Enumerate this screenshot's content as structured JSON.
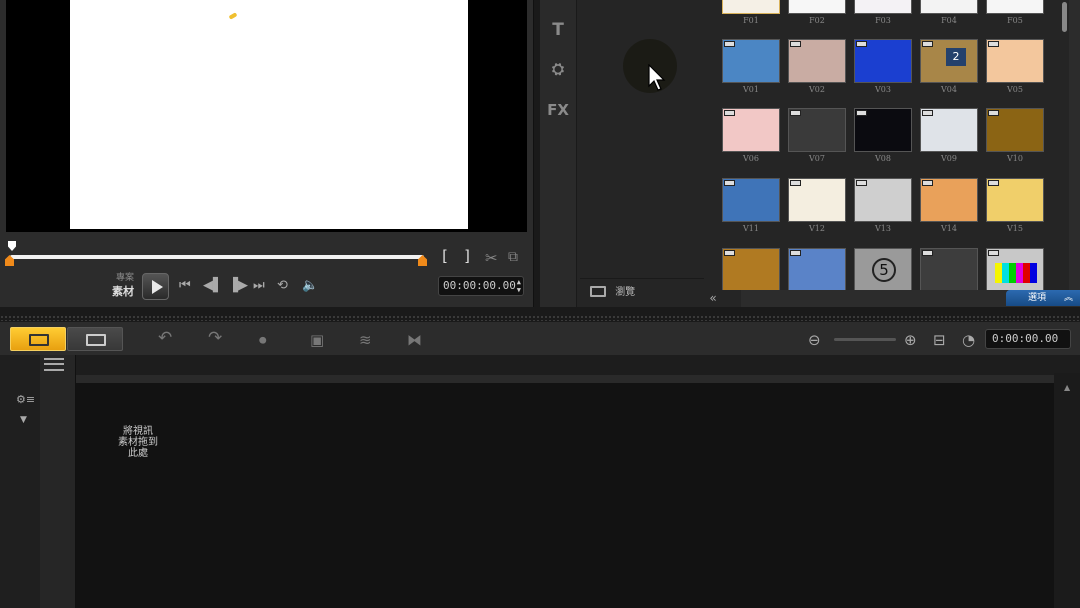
{
  "preview": {
    "mode_project": "專案",
    "mode_clip": "素材",
    "timecode": "00:00:00.00",
    "mark_in": "[",
    "mark_out": "]"
  },
  "library": {
    "side_tools": [
      "T",
      "FX"
    ],
    "browse_label": "瀏覽",
    "options_label": "選項",
    "thumbs": [
      {
        "label": "F01",
        "color": "#f5f0e6",
        "video": false
      },
      {
        "label": "F02",
        "color": "#f7f7f7",
        "video": false
      },
      {
        "label": "F03",
        "color": "#f4f2f5",
        "video": false
      },
      {
        "label": "F04",
        "color": "#f3f3f3",
        "video": false
      },
      {
        "label": "F05",
        "color": "#f6f6f6",
        "video": false
      },
      {
        "label": "V01",
        "color": "#4b86c4",
        "video": true
      },
      {
        "label": "V02",
        "color": "#c9aca3",
        "video": true
      },
      {
        "label": "V03",
        "color": "#1b3fd0",
        "video": true
      },
      {
        "label": "V04",
        "color": "#a88648",
        "video": true
      },
      {
        "label": "V05",
        "color": "#f3c79d",
        "video": true
      },
      {
        "label": "V06",
        "color": "#f2c8c6",
        "video": true
      },
      {
        "label": "V07",
        "color": "#3a3a3a",
        "video": true
      },
      {
        "label": "V08",
        "color": "#0b0b10",
        "video": true
      },
      {
        "label": "V09",
        "color": "#dfe3e8",
        "video": true
      },
      {
        "label": "V10",
        "color": "#8b6414",
        "video": true
      },
      {
        "label": "V11",
        "color": "#3f74b8",
        "video": true
      },
      {
        "label": "V12",
        "color": "#f4eee0",
        "video": true
      },
      {
        "label": "V13",
        "color": "#cfcfcf",
        "video": true
      },
      {
        "label": "V14",
        "color": "#e9a15a",
        "video": true
      },
      {
        "label": "V15",
        "color": "#f0cf6a",
        "video": true
      },
      {
        "label": "",
        "color": "#b07a22",
        "video": true
      },
      {
        "label": "",
        "color": "#5a83c8",
        "video": true
      },
      {
        "label": "",
        "color": "#9a9a9a",
        "video": false
      },
      {
        "label": "",
        "color": "#3d3d3d",
        "video": true
      },
      {
        "label": "",
        "color": "#c8c8c8",
        "video": true
      }
    ],
    "countdown_digit": "5",
    "clock_digit": "2"
  },
  "timeline": {
    "timecode": "0:00:00.00",
    "drop_hint": "將視訊\n素材拖到\n此處"
  },
  "colors": {
    "accent_gold": "#f5b72a",
    "accent_blue": "#1f5aa0",
    "in_out_marker": "#f08a1a"
  }
}
